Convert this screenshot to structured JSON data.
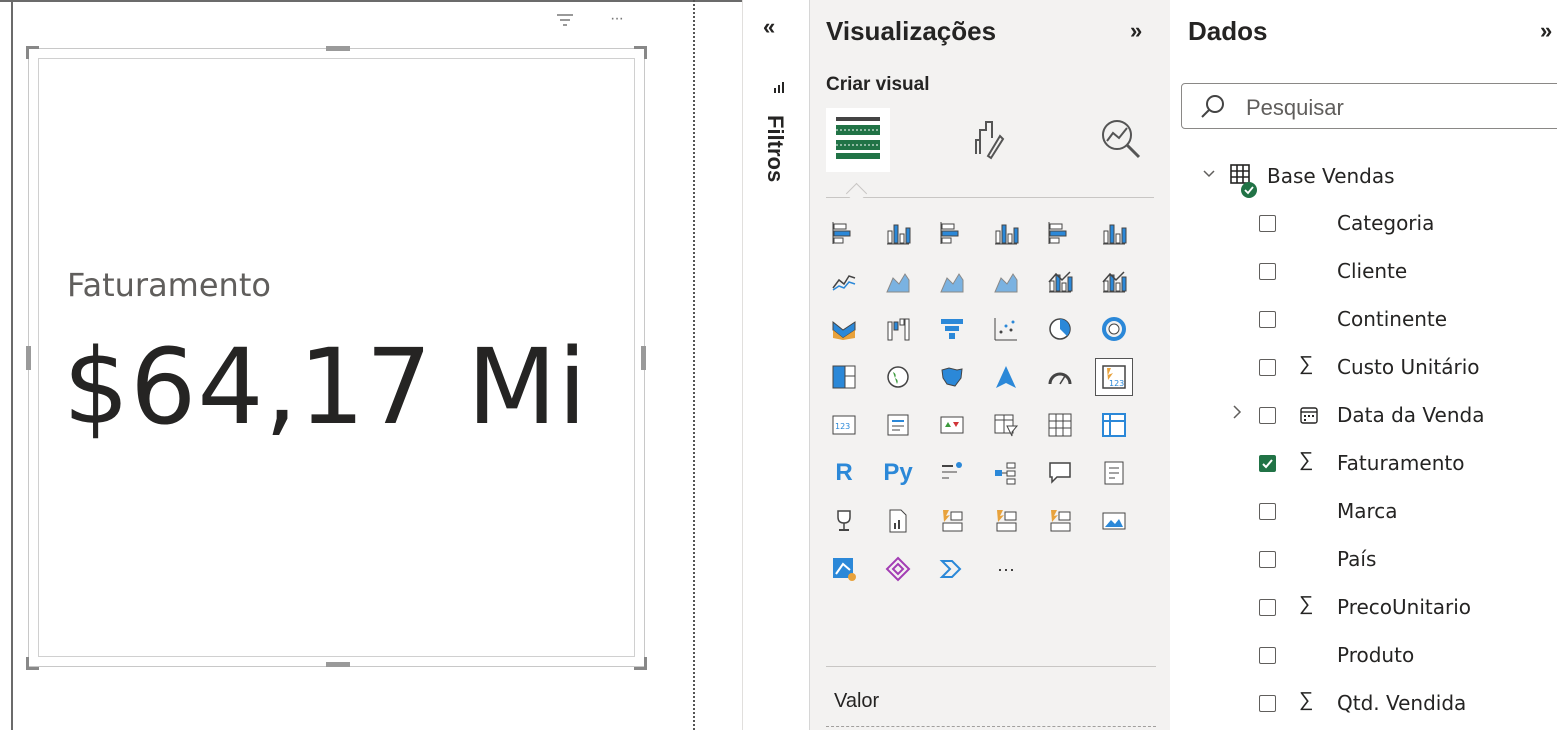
{
  "card": {
    "label": "Faturamento",
    "value": "$64,17 Mi",
    "filter_icon": "filter-icon",
    "more_icon": "more-options-icon",
    "more_glyph": "···"
  },
  "filters": {
    "collapse": "«",
    "label": "Filtros"
  },
  "visualizations": {
    "title": "Visualizações",
    "expand": "»",
    "subtitle": "Criar visual",
    "tabs": [
      "build-visual-icon",
      "format-visual-icon",
      "analytics-icon"
    ],
    "more": "···",
    "well_label": "Valor",
    "icons": [
      [
        "stacked-bar-chart-icon",
        "stacked-column-chart-icon",
        "clustered-bar-chart-icon",
        "clustered-column-chart-icon",
        "100-stacked-bar-chart-icon",
        "100-stacked-column-chart-icon"
      ],
      [
        "line-chart-icon",
        "area-chart-icon",
        "stacked-area-chart-icon",
        "100-stacked-area-chart-icon",
        "line-and-stacked-column-chart-icon",
        "line-and-clustered-column-chart-icon"
      ],
      [
        "ribbon-chart-icon",
        "waterfall-chart-icon",
        "funnel-icon",
        "scatter-chart-icon",
        "pie-chart-icon",
        "donut-chart-icon"
      ],
      [
        "treemap-icon",
        "map-icon",
        "filled-map-icon",
        "azure-map-icon",
        "gauge-icon",
        "card-icon"
      ],
      [
        "multi-row-card-icon",
        "kpi-icon",
        "slicer-icon",
        "table-icon",
        "matrix-icon",
        "new-card-icon"
      ],
      [
        "r-visual-icon",
        "python-visual-icon",
        "key-influencers-icon",
        "decomposition-tree-icon",
        "qa-icon",
        "smart-narrative-icon"
      ],
      [
        "metrics-icon",
        "paginated-report-icon",
        "power-apps-icon",
        "power-automate-icon",
        "button-slicer-icon",
        "image-icon"
      ],
      [
        "azure-maps-icon",
        "power-apps-visual-icon",
        "power-automate-visual-icon"
      ]
    ],
    "r_text": "R",
    "py_text": "Py"
  },
  "data": {
    "title": "Dados",
    "expand": "»",
    "search_placeholder": "Pesquisar",
    "table_name": "Base Vendas",
    "fields": [
      {
        "name": "Categoria",
        "sigma": false,
        "checked": false,
        "expandable": false,
        "calendar": false
      },
      {
        "name": "Cliente",
        "sigma": false,
        "checked": false,
        "expandable": false,
        "calendar": false
      },
      {
        "name": "Continente",
        "sigma": false,
        "checked": false,
        "expandable": false,
        "calendar": false
      },
      {
        "name": "Custo Unitário",
        "sigma": true,
        "checked": false,
        "expandable": false,
        "calendar": false
      },
      {
        "name": "Data da Venda",
        "sigma": false,
        "checked": false,
        "expandable": true,
        "calendar": true
      },
      {
        "name": "Faturamento",
        "sigma": true,
        "checked": true,
        "expandable": false,
        "calendar": false
      },
      {
        "name": "Marca",
        "sigma": false,
        "checked": false,
        "expandable": false,
        "calendar": false
      },
      {
        "name": "País",
        "sigma": false,
        "checked": false,
        "expandable": false,
        "calendar": false
      },
      {
        "name": "PrecoUnitario",
        "sigma": true,
        "checked": false,
        "expandable": false,
        "calendar": false
      },
      {
        "name": "Produto",
        "sigma": false,
        "checked": false,
        "expandable": false,
        "calendar": false
      },
      {
        "name": "Qtd. Vendida",
        "sigma": true,
        "checked": false,
        "expandable": false,
        "calendar": false
      }
    ],
    "sigma_glyph": "∑",
    "chevron_right": "›",
    "chevron_down": "⌄"
  },
  "colors": {
    "accent": "#217346",
    "blue": "#2b88d8",
    "dark": "#252423"
  }
}
